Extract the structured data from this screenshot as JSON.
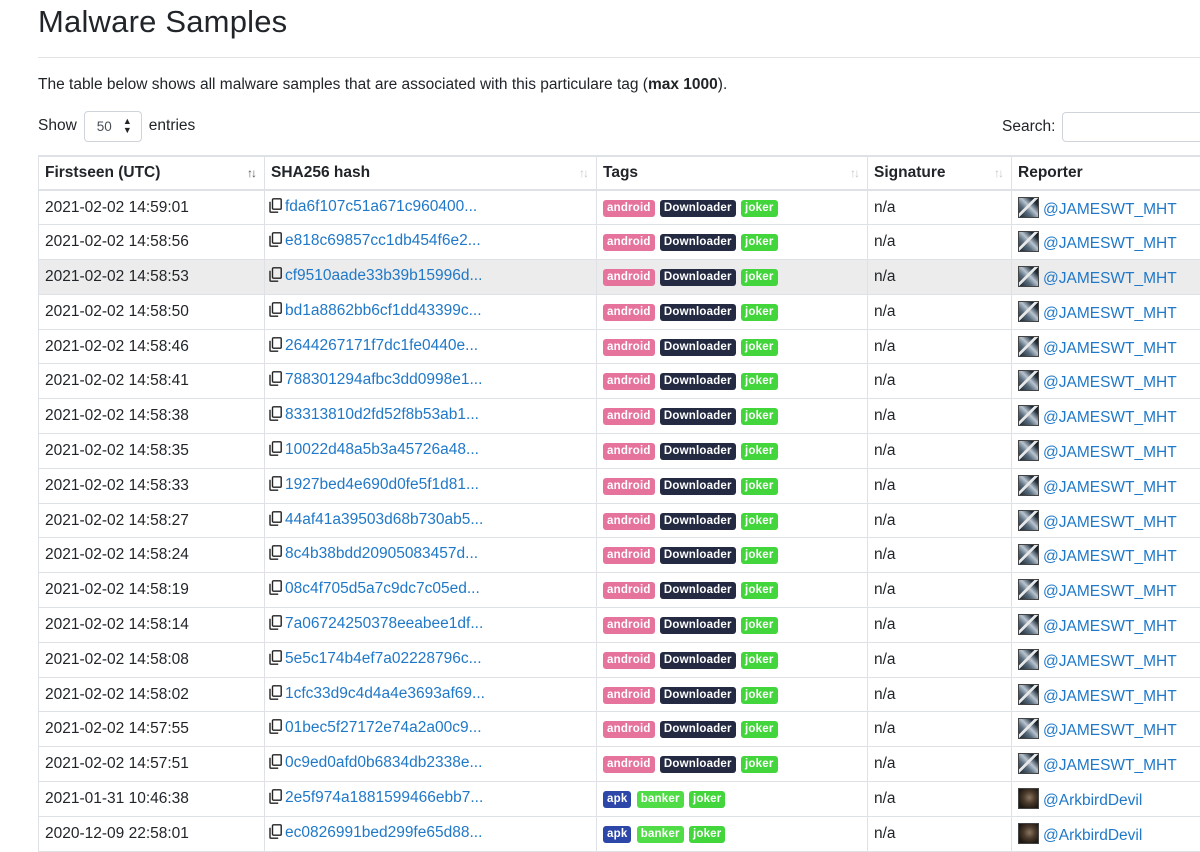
{
  "page": {
    "title": "Malware Samples",
    "intro_text": "The table below shows all malware samples that are associated with this particulare tag (",
    "intro_bold": "max 1000",
    "intro_end": ")."
  },
  "controls": {
    "show_label": "Show",
    "entries_value": "50",
    "entries_label": "entries",
    "search_label": "Search:",
    "search_value": ""
  },
  "table": {
    "headers": [
      "Firstseen (UTC)",
      "SHA256 hash",
      "Tags",
      "Signature",
      "Reporter"
    ],
    "rows": [
      {
        "firstseen": "2021-02-02 14:59:01",
        "hash": "fda6f107c51a671c960400...",
        "tags": [
          "android",
          "Downloader",
          "joker"
        ],
        "signature": "n/a",
        "reporter": "@JAMESWT_MHT"
      },
      {
        "firstseen": "2021-02-02 14:58:56",
        "hash": "e818c69857cc1db454f6e2...",
        "tags": [
          "android",
          "Downloader",
          "joker"
        ],
        "signature": "n/a",
        "reporter": "@JAMESWT_MHT"
      },
      {
        "firstseen": "2021-02-02 14:58:53",
        "hash": "cf9510aade33b39b15996d...",
        "tags": [
          "android",
          "Downloader",
          "joker"
        ],
        "signature": "n/a",
        "reporter": "@JAMESWT_MHT"
      },
      {
        "firstseen": "2021-02-02 14:58:50",
        "hash": "bd1a8862bb6cf1dd43399c...",
        "tags": [
          "android",
          "Downloader",
          "joker"
        ],
        "signature": "n/a",
        "reporter": "@JAMESWT_MHT"
      },
      {
        "firstseen": "2021-02-02 14:58:46",
        "hash": "2644267171f7dc1fe0440e...",
        "tags": [
          "android",
          "Downloader",
          "joker"
        ],
        "signature": "n/a",
        "reporter": "@JAMESWT_MHT"
      },
      {
        "firstseen": "2021-02-02 14:58:41",
        "hash": "788301294afbc3dd0998e1...",
        "tags": [
          "android",
          "Downloader",
          "joker"
        ],
        "signature": "n/a",
        "reporter": "@JAMESWT_MHT"
      },
      {
        "firstseen": "2021-02-02 14:58:38",
        "hash": "83313810d2fd52f8b53ab1...",
        "tags": [
          "android",
          "Downloader",
          "joker"
        ],
        "signature": "n/a",
        "reporter": "@JAMESWT_MHT"
      },
      {
        "firstseen": "2021-02-02 14:58:35",
        "hash": "10022d48a5b3a45726a48...",
        "tags": [
          "android",
          "Downloader",
          "joker"
        ],
        "signature": "n/a",
        "reporter": "@JAMESWT_MHT"
      },
      {
        "firstseen": "2021-02-02 14:58:33",
        "hash": "1927bed4e690d0fe5f1d81...",
        "tags": [
          "android",
          "Downloader",
          "joker"
        ],
        "signature": "n/a",
        "reporter": "@JAMESWT_MHT"
      },
      {
        "firstseen": "2021-02-02 14:58:27",
        "hash": "44af41a39503d68b730ab5...",
        "tags": [
          "android",
          "Downloader",
          "joker"
        ],
        "signature": "n/a",
        "reporter": "@JAMESWT_MHT"
      },
      {
        "firstseen": "2021-02-02 14:58:24",
        "hash": "8c4b38bdd20905083457d...",
        "tags": [
          "android",
          "Downloader",
          "joker"
        ],
        "signature": "n/a",
        "reporter": "@JAMESWT_MHT"
      },
      {
        "firstseen": "2021-02-02 14:58:19",
        "hash": "08c4f705d5a7c9dc7c05ed...",
        "tags": [
          "android",
          "Downloader",
          "joker"
        ],
        "signature": "n/a",
        "reporter": "@JAMESWT_MHT"
      },
      {
        "firstseen": "2021-02-02 14:58:14",
        "hash": "7a06724250378eeabee1df...",
        "tags": [
          "android",
          "Downloader",
          "joker"
        ],
        "signature": "n/a",
        "reporter": "@JAMESWT_MHT"
      },
      {
        "firstseen": "2021-02-02 14:58:08",
        "hash": "5e5c174b4ef7a02228796c...",
        "tags": [
          "android",
          "Downloader",
          "joker"
        ],
        "signature": "n/a",
        "reporter": "@JAMESWT_MHT"
      },
      {
        "firstseen": "2021-02-02 14:58:02",
        "hash": "1cfc33d9c4d4a4e3693af69...",
        "tags": [
          "android",
          "Downloader",
          "joker"
        ],
        "signature": "n/a",
        "reporter": "@JAMESWT_MHT"
      },
      {
        "firstseen": "2021-02-02 14:57:55",
        "hash": "01bec5f27172e74a2a00c9...",
        "tags": [
          "android",
          "Downloader",
          "joker"
        ],
        "signature": "n/a",
        "reporter": "@JAMESWT_MHT"
      },
      {
        "firstseen": "2021-02-02 14:57:51",
        "hash": "0c9ed0afd0b6834db2338e...",
        "tags": [
          "android",
          "Downloader",
          "joker"
        ],
        "signature": "n/a",
        "reporter": "@JAMESWT_MHT"
      },
      {
        "firstseen": "2021-01-31 10:46:38",
        "hash": "2e5f974a1881599466ebb7...",
        "tags": [
          "apk",
          "banker",
          "joker"
        ],
        "signature": "n/a",
        "reporter": "@ArkbirdDevil"
      },
      {
        "firstseen": "2020-12-09 22:58:01",
        "hash": "ec0826991bed299fe65d88...",
        "tags": [
          "apk",
          "banker",
          "joker"
        ],
        "signature": "n/a",
        "reporter": "@ArkbirdDevil"
      }
    ]
  },
  "tag_colors": {
    "android": "#e5739c",
    "Downloader": "#232a42",
    "joker": "#43d63c",
    "apk": "#2c47a8",
    "banker": "#50dc46"
  },
  "icons": {
    "copy": "copy-icon",
    "sort_inactive": "sort-both-icon",
    "sort_active": "sort-desc-icon"
  },
  "colors": {
    "link": "#1f78c8",
    "row_hover": "#ececec",
    "border": "#dee2e6"
  }
}
